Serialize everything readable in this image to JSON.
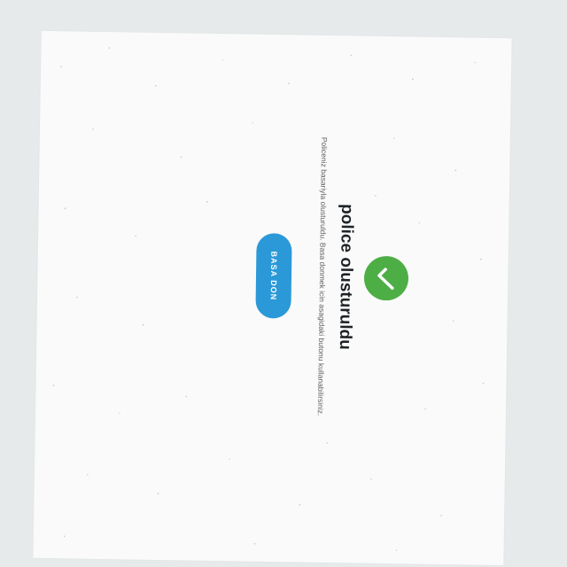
{
  "success_screen": {
    "title": "police olusturuldu",
    "description": "Policeniz basariyla olusturuldu. Basa donmek icin asagidaki butonu kullanabilirsiniz.",
    "button_label": "BASA DON",
    "icon": "check-icon"
  },
  "colors": {
    "background": "#e6eaeb",
    "card": "#fafafa",
    "success_green": "#4eae46",
    "button_blue": "#2b99d8",
    "title_text": "#1f2326",
    "body_text": "#5b5f62"
  }
}
